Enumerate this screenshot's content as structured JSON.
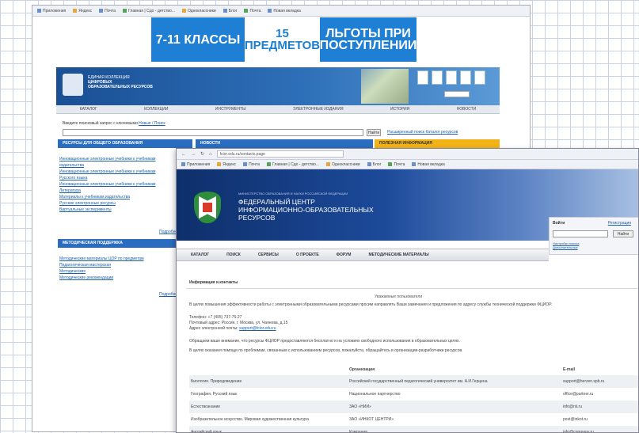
{
  "screenshot1": {
    "bookmarks": [
      "Приложения",
      "Яндекс",
      "Почта",
      "Главная | Сдо - детство...",
      "Одноклассники",
      "Блог",
      "Почта",
      "Новая вкладка"
    ],
    "banner": [
      "7-11 КЛАССЫ",
      "15 ПРЕДМЕТОВ",
      "ЛЬГОТЫ ПРИ ПОСТУПЛЕНИИ"
    ],
    "site_title_lines": [
      "ЕДИНАЯ КОЛЛЕКЦИЯ",
      "ЦИФРОВЫХ",
      "ОБРАЗОВАТЕЛЬНЫХ РЕСУРСОВ"
    ],
    "nav": [
      "КАТАЛОГ",
      "КОЛЛЕКЦИИ",
      "ИНСТРУМЕНТЫ",
      "ЭЛЕКТРОННЫЕ ИЗДАНИЯ",
      "ИСТОРИЯ",
      "НОВОСТИ"
    ],
    "search_label": "Введите поисковый запрос с ключевыми",
    "search_link": "Новые / Поиск",
    "find_button": "Найти",
    "search_links": "Расширенный поиск   Каталог ресурсов",
    "panel_heads": [
      "РЕСУРСЫ ДЛЯ ОБЩЕГО ОБРАЗОВАНИЯ",
      "НОВОСТИ",
      "ПОЛЕЗНАЯ ИНФОРМАЦИЯ"
    ],
    "list1": [
      "Инновационные электронные учебники к учебникам",
      "издательства",
      "Инновационные электронные учебники к учебникам",
      "Русского языка",
      "Инновационные электронные учебники к учебникам",
      "Литература",
      "Материалы к учебникам издательства",
      "Русские электронные ресурсы",
      "Виртуальные эксперименты"
    ],
    "more1": "Подробнее",
    "panel4": "МЕТОДИЧЕСКАЯ ПОДДЕРЖКА",
    "list2": [
      "Методические материалы ЦОР по предметам",
      "Педагогическая мастерская",
      "Методические",
      "Методические рекомендации"
    ],
    "more2": "Подробнее"
  },
  "screenshot2": {
    "url": "fcior.edu.ru/contacts.page",
    "bookmarks": [
      "Приложения",
      "Яндекс",
      "Почта",
      "Главная | Сдо - детство...",
      "Одноклассники",
      "Блог",
      "Почта",
      "Новая вкладка"
    ],
    "ministry": "МИНИСТЕРСТВО ОБРАЗОВАНИЯ И НАУКИ РОССИЙСКОЙ ФЕДЕРАЦИИ",
    "title_lines": [
      "ФЕДЕРАЛЬНЫЙ ЦЕНТР",
      "ИНФОРМАЦИОННО-ОБРАЗОВАТЕЛЬНЫХ",
      "РЕСУРСОВ"
    ],
    "login": {
      "title": "Войти",
      "register": "Регистрация",
      "button": "Найти",
      "links": [
        "Настройки поиска",
        "Дополнительные"
      ]
    },
    "nav": [
      "КАТАЛОГ",
      "ПОИСК",
      "СЕРВИСЫ",
      "О ПРОЕКТЕ",
      "ФОРУМ",
      "МЕТОДИЧЕСКИЕ МАТЕРИАЛЫ"
    ],
    "section_title": "Информация и контакты",
    "centered": "Уважаемые пользователи",
    "para1": "В целях повышения эффективности работы с электронными образовательными ресурсами просим направлять Ваши замечания и предложения по адресу службы технической поддержки ФЦИОР.",
    "contact_phone": "Телефон: +7 (495) 737-75-27",
    "contact_addr": "Почтовый адрес: Россия, г. Москва, ул. Чаянова, д.15",
    "contact_email_label": "Адрес электронной почты:",
    "contact_email": "support@fcior.edu.ru",
    "para2": "Обращаем ваше внимание, что ресурсы ФЦИОР предоставляются бесплатно и на условиях свободного использования в образовательных целях.",
    "para3": "В целях оказания помощи по проблемам, связанным с использованием ресурсов, пожалуйста, обращайтесь в организации-разработчики ресурсов.",
    "table_headers": [
      "",
      "Организация",
      "E-mail"
    ],
    "table_rows": [
      [
        "Биология. Природоведение",
        "Российский государственный педагогический университет им. А.И.Герцена",
        "support@herzen.spb.ru"
      ],
      [
        "География. Русский язык",
        "Национальное партнерство",
        "office@partner.ru"
      ],
      [
        "Естествознание",
        "ЗАО «НИИ»",
        "info@nii.ru"
      ],
      [
        "Изобразительное искусство. Мировая художественная культура",
        "ЗАО «ИНКОТ ЦЕНТРИ»",
        "post@inkot.ru"
      ],
      [
        "Английский язык",
        "Компания",
        "info@company.ru"
      ]
    ]
  }
}
